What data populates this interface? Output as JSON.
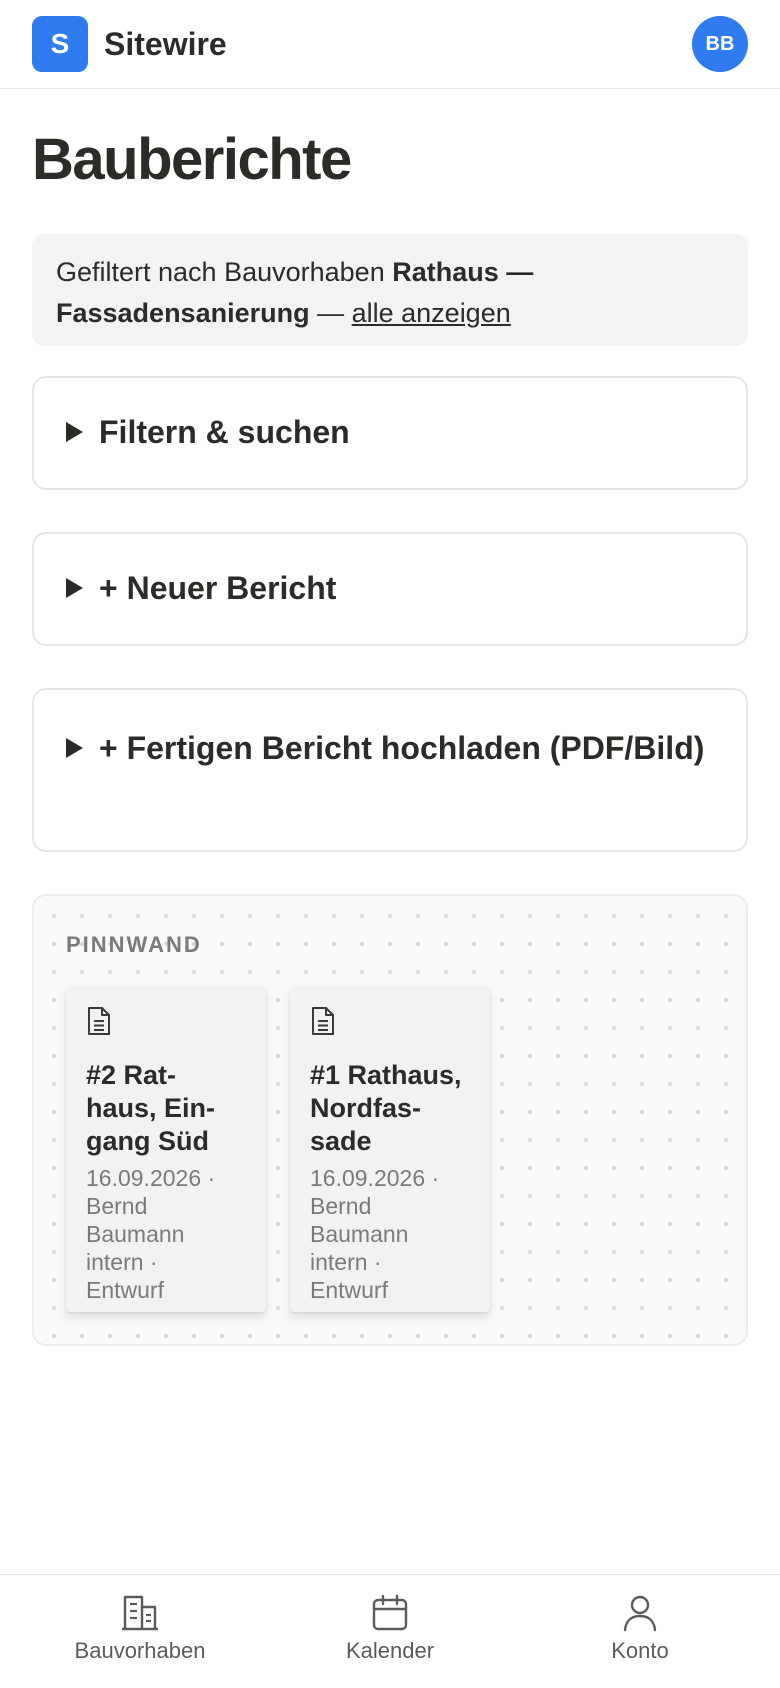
{
  "header": {
    "logo_letter": "S",
    "app_name": "Sitewire",
    "avatar_initials": "BB"
  },
  "page": {
    "title": "Bauberichte"
  },
  "filter_note": {
    "prefix": "Gefiltert nach Bauvorhaben ",
    "project": "Rathaus — Fassadensanierung",
    "separator": " — ",
    "show_all_link": "alle anzeigen"
  },
  "sections": [
    {
      "label": "Filtern & suchen",
      "icon": "triangle-right-icon"
    },
    {
      "label": "+ Neuer Bericht",
      "icon": "triangle-right-icon"
    },
    {
      "label": "+ Fertigen Bericht hochladen (PDF/Bild)",
      "icon": "triangle-right-icon"
    }
  ],
  "pinboard": {
    "label": "PINNWAND",
    "notes": [
      {
        "title": "#2 Rat-haus, Ein-gang Süd",
        "title_lines": [
          "#2 Rat-",
          "haus, Ein-",
          "gang Süd"
        ],
        "meta_lines": [
          "16.09.2026 ·",
          "Bernd",
          "Baumann",
          "intern ·",
          "Entwurf"
        ],
        "icon": "document-icon"
      },
      {
        "title": "#1 Rathaus, Nordfas-sade",
        "title_lines": [
          "#1 Rathaus,",
          "Nordfas-",
          "sade"
        ],
        "meta_lines": [
          "16.09.2026 ·",
          "Bernd",
          "Baumann",
          "intern ·",
          "Entwurf"
        ],
        "icon": "document-icon"
      }
    ]
  },
  "bottom_nav": [
    {
      "label": "Bauvorhaben",
      "icon": "building-icon"
    },
    {
      "label": "Kalender",
      "icon": "calendar-icon"
    },
    {
      "label": "Konto",
      "icon": "user-icon"
    }
  ],
  "colors": {
    "accent": "#2f7bf0",
    "text": "#2b2b27",
    "muted": "#7a7a76",
    "panel": "#f3f3f3"
  }
}
